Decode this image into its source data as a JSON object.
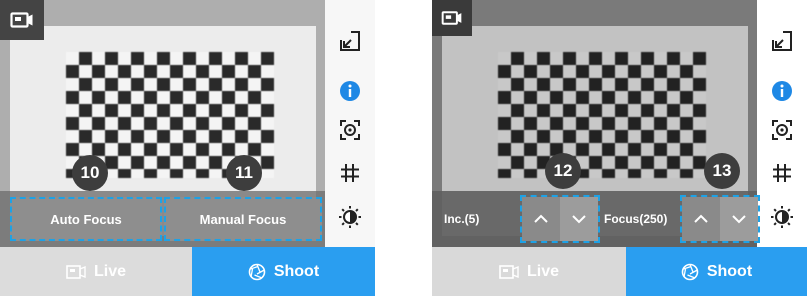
{
  "colors": {
    "accent": "#2a9ef0",
    "highlight": "#1ea2e6",
    "info": "#1e88e5"
  },
  "left_panel": {
    "icons": {
      "camera": "video-camera-icon",
      "external": "external-link-icon",
      "info": "info-icon",
      "focus_target": "focus-target-icon",
      "grid": "grid-hash-icon",
      "brightness": "brightness-icon"
    },
    "buttons": {
      "auto_focus": "Auto Focus",
      "manual_focus": "Manual Focus"
    },
    "badges": {
      "auto_focus": "10",
      "manual_focus": "11"
    },
    "bottom": {
      "live": "Live",
      "shoot": "Shoot"
    }
  },
  "right_panel": {
    "controls": {
      "increment": "Inc.(5)",
      "focus": "Focus(250)"
    },
    "badges": {
      "increment_group": "12",
      "focus_group": "13"
    },
    "bottom": {
      "live": "Live",
      "shoot": "Shoot"
    }
  }
}
